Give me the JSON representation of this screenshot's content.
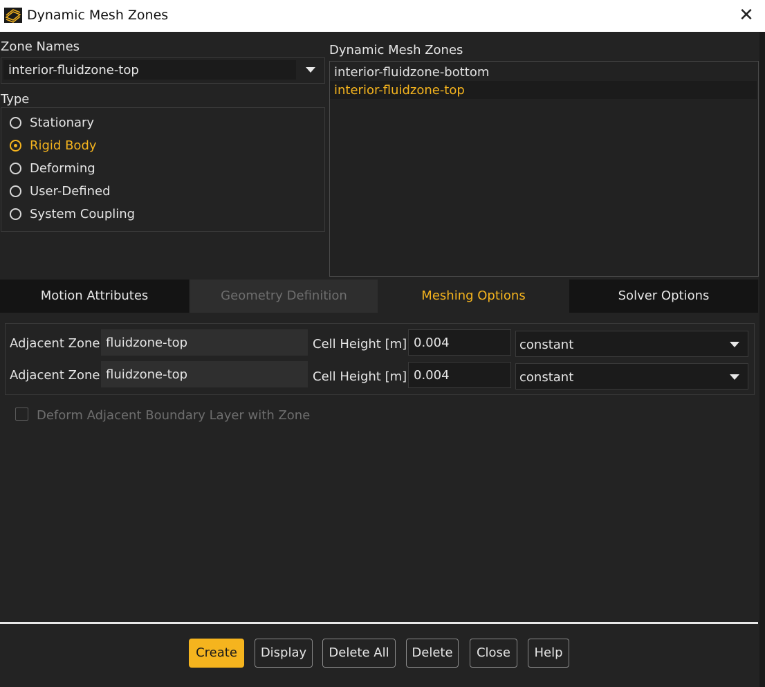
{
  "window": {
    "title": "Dynamic Mesh Zones",
    "close_glyph": "✕"
  },
  "zone_names": {
    "label": "Zone Names",
    "selected": "interior-fluidzone-top"
  },
  "type": {
    "label": "Type",
    "options": [
      "Stationary",
      "Rigid Body",
      "Deforming",
      "User-Defined",
      "System Coupling"
    ],
    "selected": "Rigid Body"
  },
  "dynamic_mesh_zones": {
    "label": "Dynamic Mesh Zones",
    "items": [
      "interior-fluidzone-bottom",
      "interior-fluidzone-top"
    ],
    "selected": "interior-fluidzone-top"
  },
  "tabs": [
    {
      "label": "Motion Attributes",
      "state": "normal"
    },
    {
      "label": "Geometry Definition",
      "state": "disabled"
    },
    {
      "label": "Meshing Options",
      "state": "active"
    },
    {
      "label": "Solver Options",
      "state": "normal"
    }
  ],
  "meshing": {
    "rows": [
      {
        "adjacent_label": "Adjacent Zone",
        "adjacent_value": "fluidzone-top",
        "height_label": "Cell Height [m]",
        "height_value": "0.004",
        "method": "constant"
      },
      {
        "adjacent_label": "Adjacent Zone",
        "adjacent_value": "fluidzone-top",
        "height_label": "Cell Height [m]",
        "height_value": "0.004",
        "method": "constant"
      }
    ],
    "deform_checkbox": {
      "label": "Deform Adjacent Boundary Layer with Zone",
      "checked": false,
      "enabled": false
    }
  },
  "buttons": {
    "create": "Create",
    "display": "Display",
    "delete_all": "Delete All",
    "delete": "Delete",
    "close": "Close",
    "help": "Help"
  },
  "colors": {
    "accent": "#f5b41e",
    "background": "#232323",
    "disabled_text": "#6e6e6e"
  }
}
